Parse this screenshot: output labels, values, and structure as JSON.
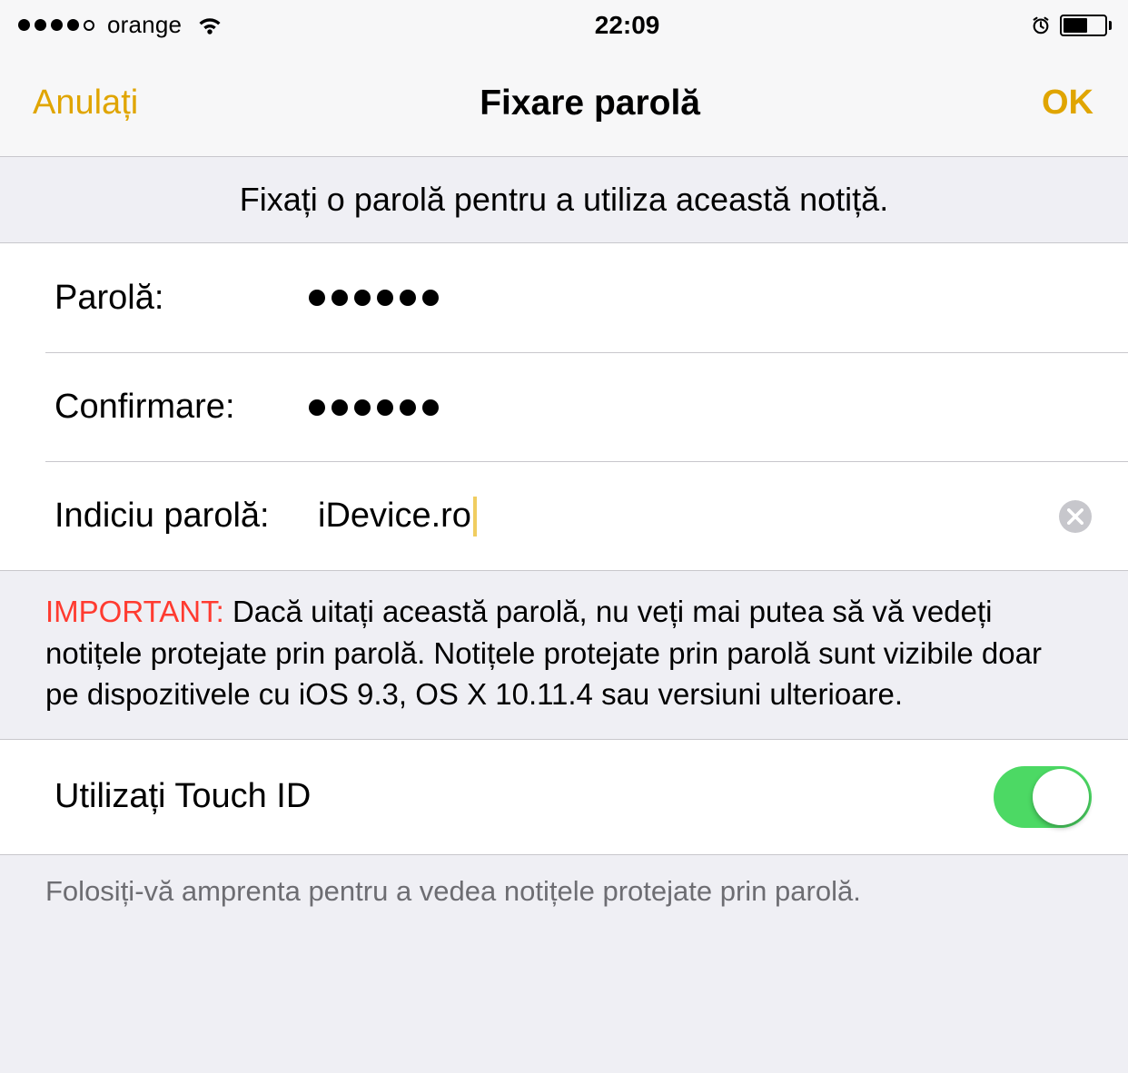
{
  "status_bar": {
    "carrier": "orange",
    "time": "22:09"
  },
  "nav": {
    "cancel": "Anulați",
    "title": "Fixare parolă",
    "ok": "OK"
  },
  "header": "Fixați o parolă pentru a utiliza această notiță.",
  "fields": {
    "password_label": "Parolă:",
    "confirm_label": "Confirmare:",
    "hint_label": "Indiciu parolă:",
    "hint_value": "iDevice.ro",
    "password_dots": 6,
    "confirm_dots": 6
  },
  "important": {
    "label": "IMPORTANT:",
    "text": " Dacă uitați această parolă, nu veți mai putea să vă vedeți notițele protejate prin parolă. Notițele protejate prin parolă sunt vizibile doar pe dispozitivele cu iOS 9.3, OS X 10.11.4 sau versiuni ulterioare."
  },
  "touchid": {
    "label": "Utilizați Touch ID",
    "on": true,
    "footer": "Folosiți-vă amprenta pentru a vedea notițele protejate prin parolă."
  }
}
